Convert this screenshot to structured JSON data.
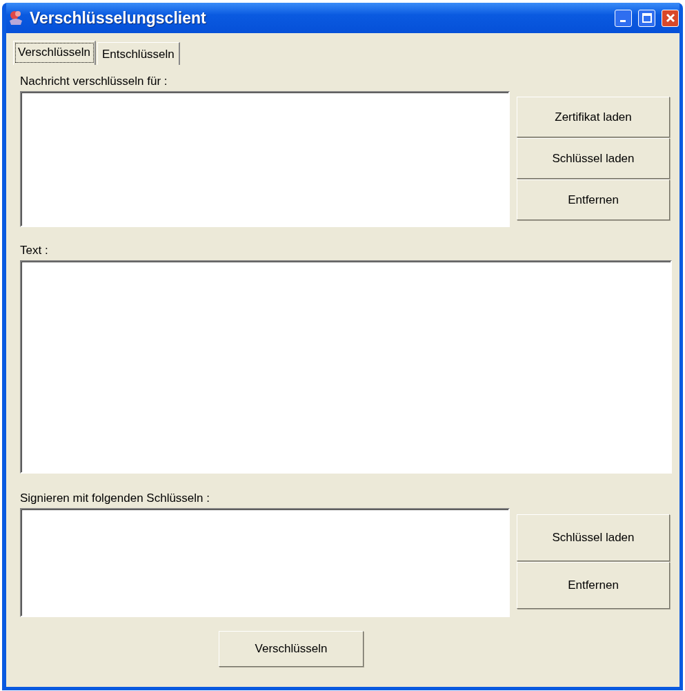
{
  "window": {
    "title": "Verschlüsselungsclient"
  },
  "tabs": [
    {
      "label": "Verschlüsseln",
      "selected": true
    },
    {
      "label": "Entschlüsseln",
      "selected": false
    }
  ],
  "recipients": {
    "label": "Nachricht verschlüsseln für :",
    "buttons": [
      "Zertifikat laden",
      "Schlüssel laden",
      "Entfernen"
    ]
  },
  "text": {
    "label": "Text :"
  },
  "signers": {
    "label": "Signieren mit folgenden Schlüsseln :",
    "buttons": [
      "Schlüssel laden",
      "Entfernen"
    ]
  },
  "action_button": "Verschlüsseln"
}
